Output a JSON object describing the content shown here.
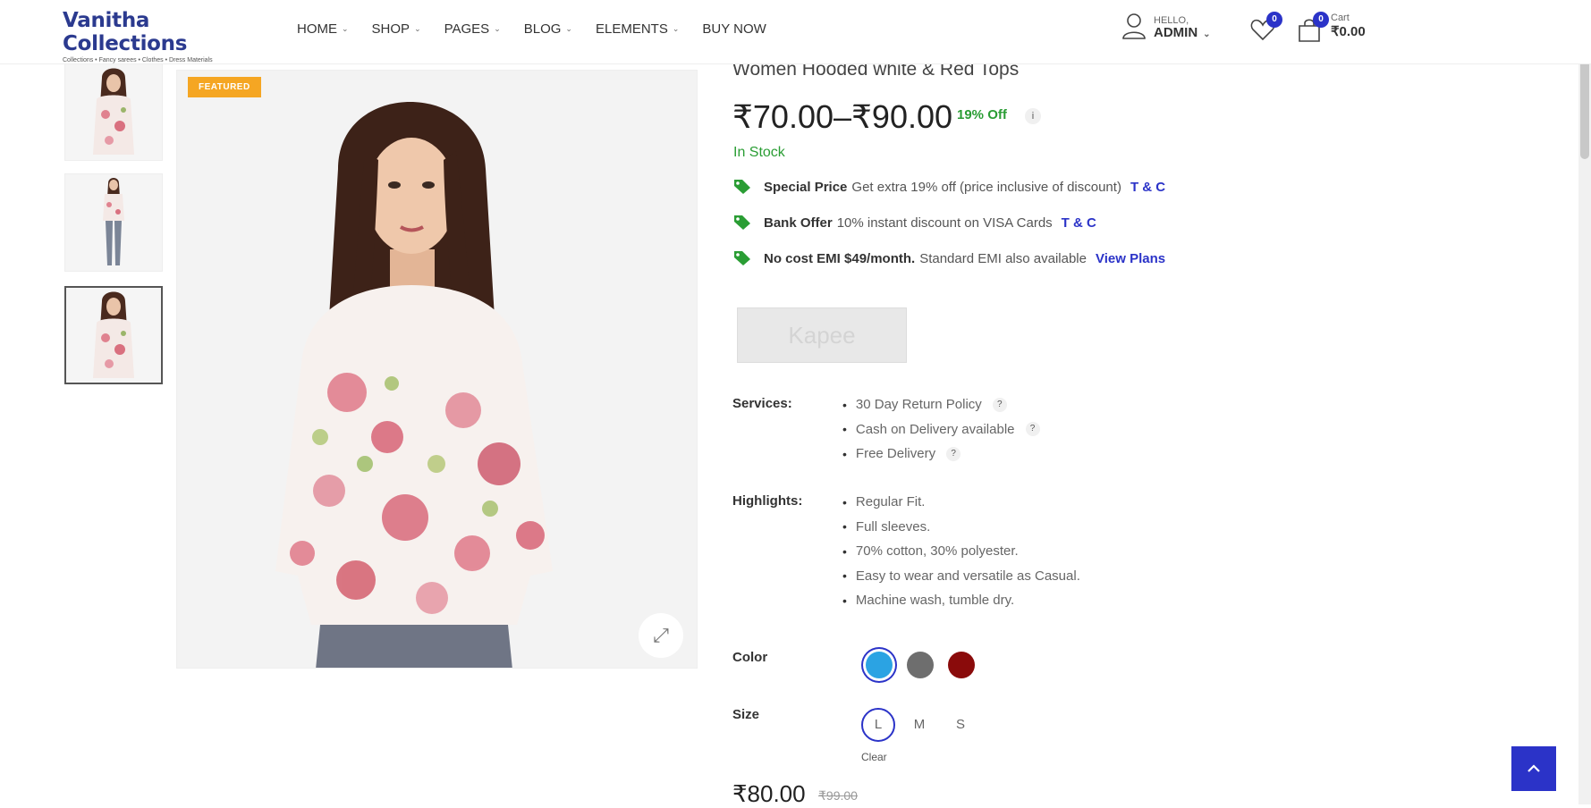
{
  "header": {
    "logo_title": "Vanitha Collections",
    "logo_tagline": "Collections • Fancy sarees • Clothes • Dress Materials",
    "nav": [
      "HOME",
      "SHOP",
      "PAGES",
      "BLOG",
      "ELEMENTS",
      "BUY NOW"
    ],
    "user_hello": "HELLO,",
    "user_name": "ADMIN",
    "wishlist_count": "0",
    "cart_count": "0",
    "cart_label": "Cart",
    "cart_amount": "₹0.00"
  },
  "product": {
    "badge": "FEATURED",
    "title": "Women Hooded white & Red Tops",
    "price_range": "₹70.00–₹90.00",
    "discount": "19% Off",
    "info": "i",
    "stock": "In Stock",
    "offers": [
      {
        "title": "Special Price",
        "text": "Get extra 19% off (price inclusive of discount)",
        "link": "T & C"
      },
      {
        "title": "Bank Offer",
        "text": "10% instant discount on VISA Cards",
        "link": "T & C"
      },
      {
        "title": "No cost EMI $49/month.",
        "text": "Standard EMI also available",
        "link": "View Plans"
      }
    ],
    "brand": "Kapee",
    "services_label": "Services:",
    "services": [
      "30 Day Return Policy",
      "Cash on Delivery available",
      "Free Delivery"
    ],
    "qmark": "?",
    "highlights_label": "Highlights:",
    "highlights": [
      "Regular Fit.",
      "Full sleeves.",
      "70% cotton, 30% polyester.",
      "Easy to wear and versatile as Casual.",
      "Machine wash, tumble dry."
    ],
    "color_label": "Color",
    "colors": [
      "#2ba3e3",
      "#6e6e6e",
      "#8a0b0b"
    ],
    "size_label": "Size",
    "sizes": [
      "L",
      "M",
      "S"
    ],
    "clear": "Clear",
    "final_price": "₹80.00",
    "old_price": "₹99.00"
  },
  "icons": {
    "user": "user-icon",
    "wishlist": "heart-icon",
    "cart": "cart-icon",
    "zoom": "expand-icon",
    "offer": "tag-icon",
    "back_to_top": "chevron-up-icon"
  }
}
